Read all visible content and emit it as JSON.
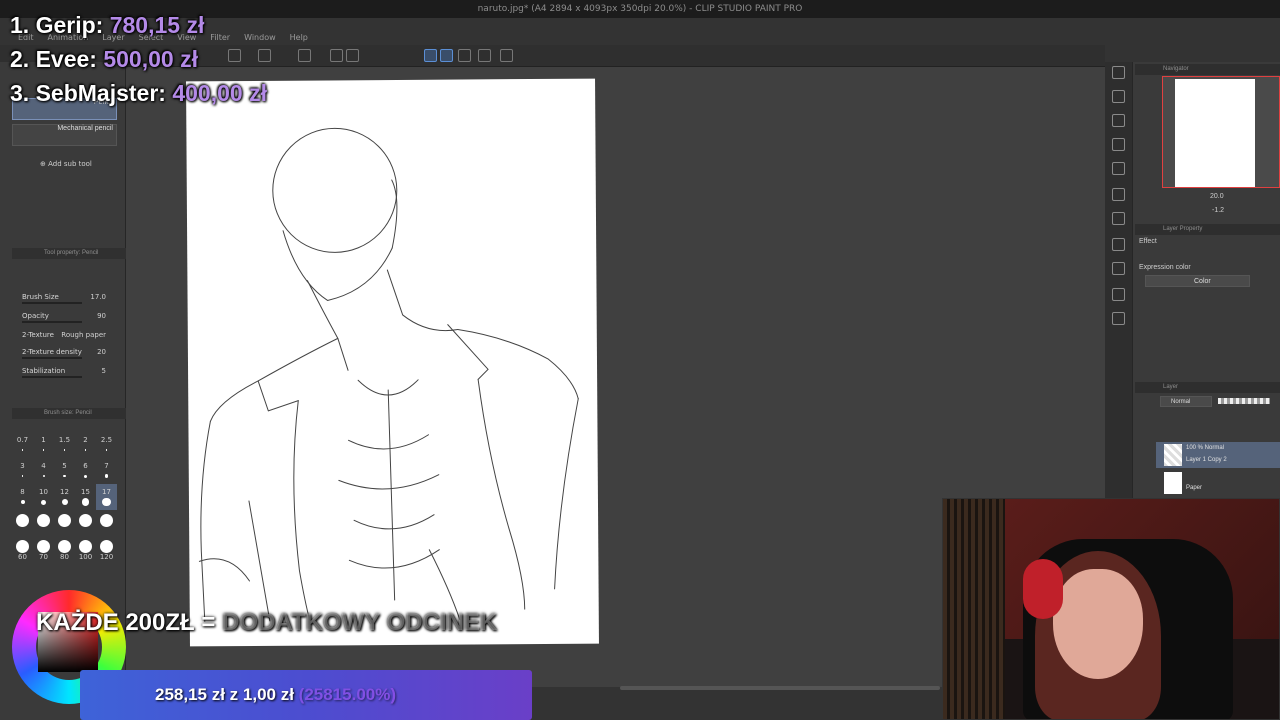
{
  "window": {
    "title": "naruto.jpg* (A4 2894 x 4093px 350dpi 20.0%) - CLIP STUDIO PAINT PRO"
  },
  "menu": [
    "Edit",
    "Animation",
    "Layer",
    "Select",
    "View",
    "Filter",
    "Window",
    "Help"
  ],
  "donors": [
    {
      "rank_name": "1. Gerip:",
      "amount": "780,15 zł"
    },
    {
      "rank_name": "2. Evee:",
      "amount": "500,00 zł"
    },
    {
      "rank_name": "3. SebMajster:",
      "amount": "400,00 zł"
    }
  ],
  "sub_tools": {
    "pencil_label": "Pencil",
    "mechanical_label": "Mechanical pencil",
    "add_sub_tool": "Add sub tool"
  },
  "tool_property": {
    "header": "Tool property: Pencil",
    "rows": [
      {
        "label": "Brush Size",
        "value": "17.0"
      },
      {
        "label": "Opacity",
        "value": "90"
      },
      {
        "label": "2-Texture",
        "value": "Rough paper"
      },
      {
        "label": "2-Texture density",
        "value": "20"
      },
      {
        "label": "Stabilization",
        "value": "5"
      }
    ]
  },
  "brush_size": {
    "header": "Brush size: Pencil",
    "sizes": [
      "0.7",
      "1",
      "1.5",
      "2",
      "2.5",
      "3",
      "4",
      "5",
      "6",
      "7",
      "8",
      "10",
      "12",
      "15",
      "17",
      "20",
      "25",
      "30",
      "40",
      "50",
      "60",
      "70",
      "80",
      "100",
      "120"
    ]
  },
  "navigator": {
    "header": "Navigator",
    "zoom": "20.0",
    "angle": "-1.2"
  },
  "layer_property": {
    "header": "Layer Property",
    "effect_label": "Effect",
    "expression_label": "Expression color",
    "expression_value": "Color"
  },
  "layers": {
    "header": "Layer",
    "blend_mode": "Normal",
    "items": [
      {
        "mode": "100 % Normal",
        "name": "Layer 1 Copy 2"
      },
      {
        "mode": "",
        "name": "Paper"
      }
    ]
  },
  "overlay": {
    "every_banner_main": "KAŻDE 200ZŁ = ",
    "every_banner_faded": "DODATKOWY ODCINEK",
    "goal_text": "258,15 zł z 1,00 zł",
    "goal_percent": "(25815.00%)"
  },
  "colors": {
    "accent_purple": "#b48ae8",
    "goal_bar_start": "#3e63d8",
    "goal_bar_end": "#6a3fc8",
    "navigator_frame": "#e04040"
  }
}
